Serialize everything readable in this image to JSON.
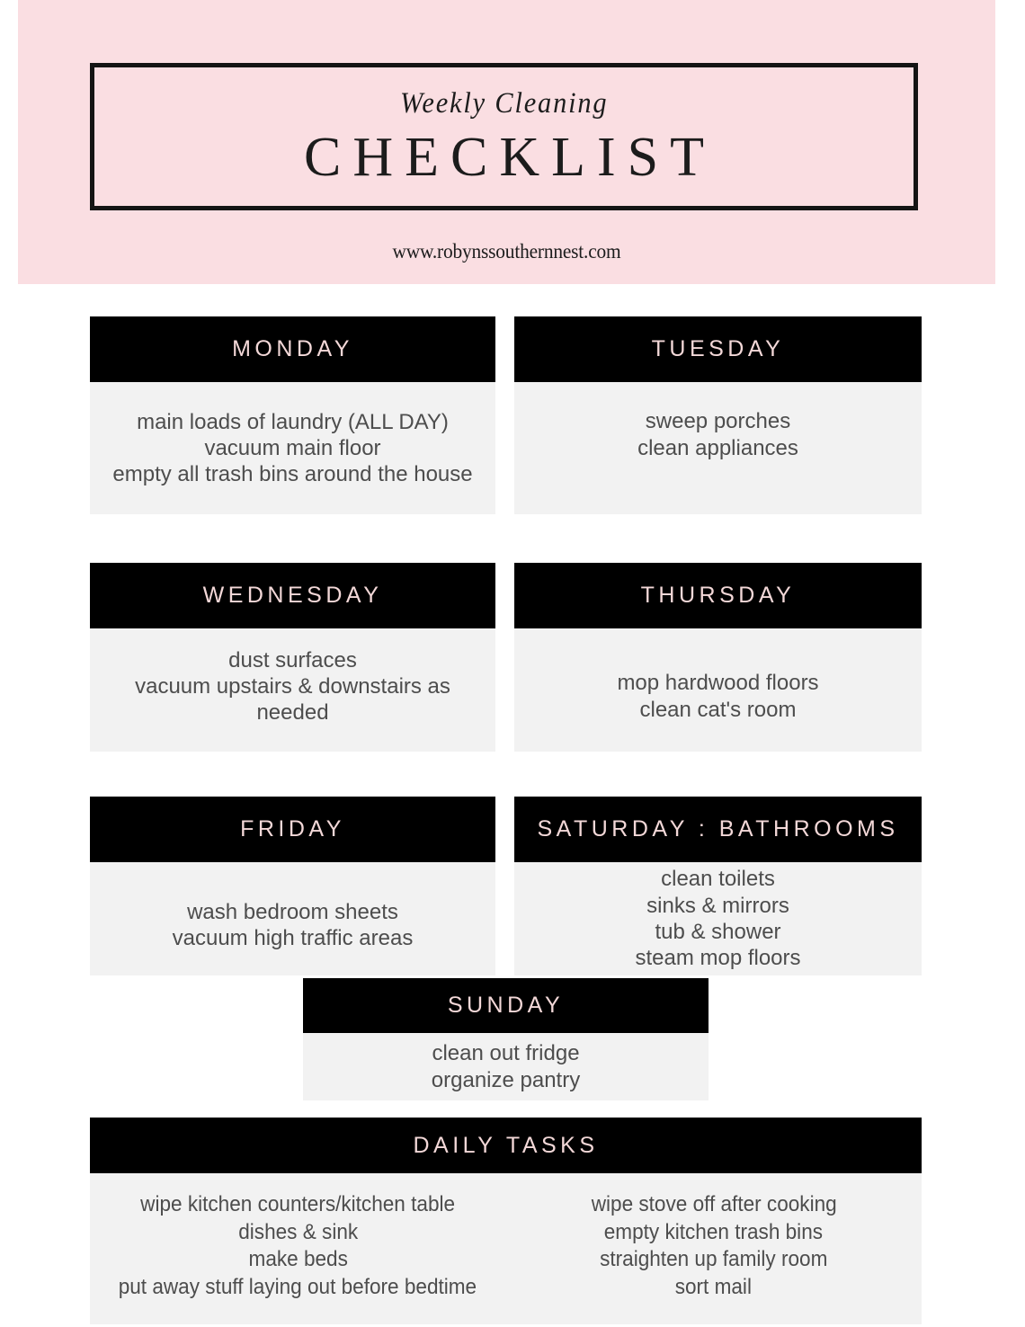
{
  "banner": {
    "script_title": "Weekly Cleaning",
    "main_title": "CHECKLIST",
    "url": "www.robynssouthernnest.com",
    "background_color": "#fadee2",
    "border_color": "#141414"
  },
  "theme": {
    "header_bar_color": "#000000",
    "header_text_color": "#f3d8d8",
    "card_body_color": "#f2f2f2",
    "body_text_color": "#4d4d4d",
    "page_background": "#ffffff"
  },
  "days": {
    "monday": {
      "label": "MONDAY",
      "tasks": [
        "main loads of laundry (ALL DAY)",
        "vacuum main floor",
        "empty all trash bins around the house"
      ]
    },
    "tuesday": {
      "label": "TUESDAY",
      "tasks": [
        "sweep porches",
        "clean appliances"
      ]
    },
    "wednesday": {
      "label": "WEDNESDAY",
      "tasks": [
        "dust surfaces",
        "vacuum upstairs & downstairs as needed"
      ]
    },
    "thursday": {
      "label": "THURSDAY",
      "tasks": [
        "mop hardwood floors",
        "clean cat's room"
      ]
    },
    "friday": {
      "label": "FRIDAY",
      "tasks": [
        "wash bedroom sheets",
        "vacuum high traffic areas"
      ]
    },
    "saturday": {
      "label": "SATURDAY : BATHROOMS",
      "tasks": [
        "clean toilets",
        "sinks & mirrors",
        "tub & shower",
        "steam mop floors"
      ]
    },
    "sunday": {
      "label": "SUNDAY",
      "tasks": [
        "clean out fridge",
        "organize pantry"
      ]
    }
  },
  "daily_tasks": {
    "label": "DAILY TASKS",
    "column_left": [
      "wipe kitchen counters/kitchen table",
      "dishes & sink",
      "make beds",
      "put away stuff laying out before bedtime"
    ],
    "column_right": [
      "wipe stove off after cooking",
      "empty kitchen trash bins",
      "straighten up family room",
      "sort mail"
    ]
  }
}
